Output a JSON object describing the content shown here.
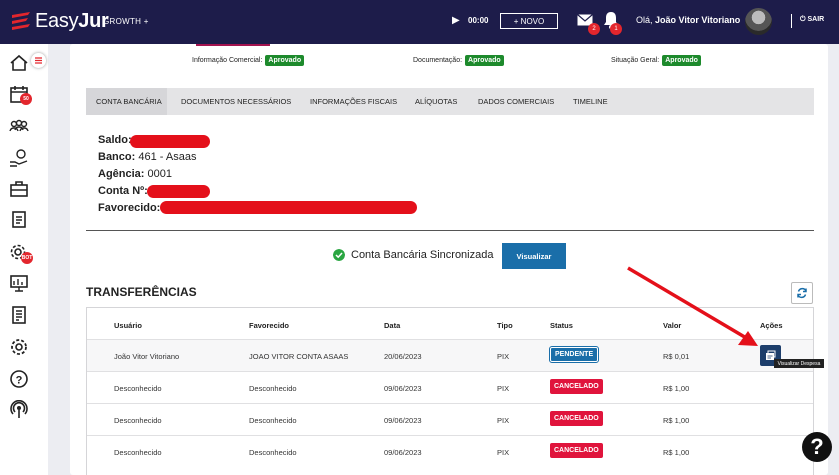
{
  "header": {
    "logo_text": "EasyJur",
    "plan": "GROWTH +",
    "timer": "00:00",
    "new_label": "+ NOVO",
    "mail_count": "2",
    "bell_count": "1",
    "greeting_prefix": "Olá, ",
    "user_name": "João Vitor Vitoriano",
    "logout": "SAIR"
  },
  "sidebar": {
    "calendar_badge": "50",
    "gear_badge": "BOT"
  },
  "approvals": [
    {
      "label": "Informação Comercial:",
      "status": "Aprovado"
    },
    {
      "label": "Documentação:",
      "status": "Aprovado"
    },
    {
      "label": "Situação Geral:",
      "status": "Aprovado"
    }
  ],
  "tabs": [
    "CONTA BANCÁRIA",
    "DOCUMENTOS NECESSÁRIOS",
    "INFORMAÇÕES FISCAIS",
    "ALÍQUOTAS",
    "DADOS COMERCIAIS",
    "TIMELINE"
  ],
  "account": {
    "saldo_label": "Saldo:",
    "banco_label": "Banco:",
    "banco_value": "461 - Asaas",
    "agencia_label": "Agência:",
    "agencia_value": "0001",
    "conta_label": "Conta Nº:",
    "favorecido_label": "Favorecido:"
  },
  "sync": {
    "text": "Conta Bancária Sincronizada",
    "button": "Visualizar"
  },
  "transfers": {
    "title": "TRANSFERÊNCIAS",
    "columns": [
      "Usuário",
      "Favorecido",
      "Data",
      "Tipo",
      "Status",
      "Valor",
      "Ações"
    ],
    "rows": [
      {
        "usuario": "João Vitor Vitoriano",
        "favorecido": "JOAO VITOR CONTA ASAAS",
        "data": "20/06/2023",
        "tipo": "PIX",
        "status": "PENDENTE",
        "valor": "R$ 0,01"
      },
      {
        "usuario": "Desconhecido",
        "favorecido": "Desconhecido",
        "data": "09/06/2023",
        "tipo": "PIX",
        "status": "CANCELADO",
        "valor": "R$ 1,00"
      },
      {
        "usuario": "Desconhecido",
        "favorecido": "Desconhecido",
        "data": "09/06/2023",
        "tipo": "PIX",
        "status": "CANCELADO",
        "valor": "R$ 1,00"
      },
      {
        "usuario": "Desconhecido",
        "favorecido": "Desconhecido",
        "data": "09/06/2023",
        "tipo": "PIX",
        "status": "CANCELADO",
        "valor": "R$ 1,00"
      }
    ],
    "tooltip": "Visualizar Despesa"
  },
  "colors": {
    "navbar": "#1d1c4a",
    "approved": "#1d8a2c",
    "pending": "#1a6ea9",
    "cancelled": "#e0143c",
    "redaction": "#e4101a"
  },
  "icons": {
    "help": "?"
  }
}
